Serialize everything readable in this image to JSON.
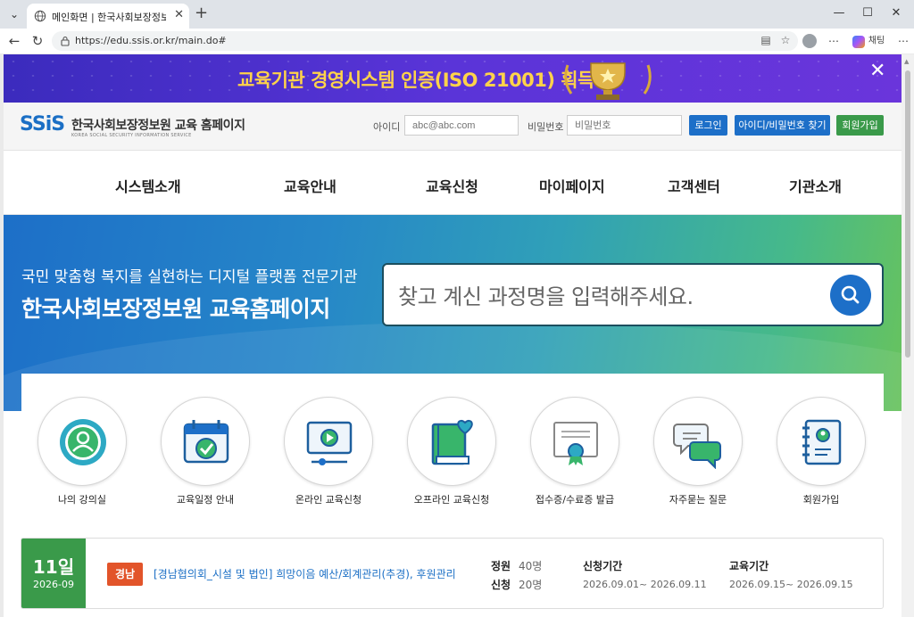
{
  "browser": {
    "tab_title": "메인화면 | 한국사회보장정보원 교",
    "url": "https://edu.ssis.or.kr/main.do#",
    "copilot_label": "채팅"
  },
  "banner": {
    "text": "교육기관 경영시스템 인증(ISO 21001) 획득"
  },
  "header": {
    "logo_mark": "SSiS",
    "logo_name": "한국사회보장정보원 교육 홈페이지",
    "logo_sub": "KOREA SOCIAL SECURITY INFORMATION SERVICE",
    "id_label": "아이디",
    "id_placeholder": "abc@abc.com",
    "pw_label": "비밀번호",
    "pw_placeholder": "비밀번호",
    "login_btn": "로그인",
    "find_btn": "아이디/비밀번호 찾기",
    "join_btn": "회원가입"
  },
  "nav": [
    "시스템소개",
    "교육안내",
    "교육신청",
    "마이페이지",
    "고객센터",
    "기관소개"
  ],
  "hero": {
    "subtitle": "국민 맞춤형 복지를 실현하는 디지털 플랫폼 전문기관",
    "title": "한국사회보장정보원 교육홈페이지",
    "search_placeholder": "찾고 계신 과정명을 입력해주세요."
  },
  "quick_menu": [
    {
      "label": "나의 강의실",
      "icon": "user-icon"
    },
    {
      "label": "교육일정 안내",
      "icon": "calendar-check-icon"
    },
    {
      "label": "온라인 교육신청",
      "icon": "video-play-icon"
    },
    {
      "label": "오프라인 교육신청",
      "icon": "book-heart-icon"
    },
    {
      "label": "접수증/수료증 발급",
      "icon": "certificate-icon"
    },
    {
      "label": "자주묻는 질문",
      "icon": "chat-bubbles-icon"
    },
    {
      "label": "회원가입",
      "icon": "member-book-icon"
    }
  ],
  "course": {
    "day": "11일",
    "year_month": "2026-09",
    "region": "경남",
    "title": "[경남협의회_시설 및 법인] 희망이음 예산/회계관리(추경), 후원관리",
    "capacity_label": "정원",
    "capacity_value": "40명",
    "applied_label": "신청",
    "applied_value": "20명",
    "apply_period_label": "신청기간",
    "apply_period": "2026.09.01~ 2026.09.11",
    "edu_period_label": "교육기간",
    "edu_period": "2026.09.15~ 2026.09.15"
  },
  "colors": {
    "primary_blue": "#1d6fc8",
    "green": "#3a9a4a",
    "region_badge": "#e2542a",
    "banner_purple": "#4a30cc",
    "banner_gold": "#ffd34a"
  }
}
